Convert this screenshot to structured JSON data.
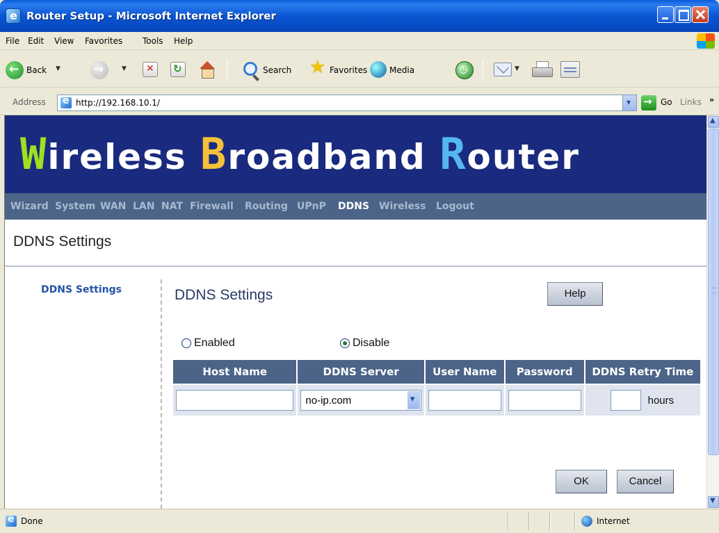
{
  "window": {
    "title": "Router Setup - Microsoft Internet Explorer"
  },
  "menu": [
    "File",
    "Edit",
    "View",
    "Favorites",
    "Tools",
    "Help"
  ],
  "toolbar": {
    "back_label": "Back",
    "search_label": "Search",
    "favorites_label": "Favorites",
    "media_label": "Media"
  },
  "address": {
    "label": "Address",
    "url": "http://192.168.10.1/",
    "go_label": "Go",
    "links_label": "Links"
  },
  "banner": {
    "w": "W",
    "w_rest": "ireless ",
    "b": "B",
    "b_rest": "roadband ",
    "r": "R",
    "r_rest": "outer"
  },
  "nav": {
    "items": [
      "Wizard",
      "System",
      "WAN",
      "LAN",
      "NAT",
      "Firewall",
      "Routing",
      "UPnP",
      "DDNS",
      "Wireless",
      "Logout"
    ],
    "active": "DDNS"
  },
  "page": {
    "heading": "DDNS Settings",
    "sidebar_link": "DDNS Settings",
    "section_title": "DDNS Settings",
    "help_label": "Help",
    "ok_label": "OK",
    "cancel_label": "Cancel"
  },
  "ddns": {
    "enabled_label": "Enabled",
    "disable_label": "Disable",
    "selected": "Disable",
    "columns": [
      "Host Name",
      "DDNS Server",
      "User Name",
      "Password",
      "DDNS Retry Time"
    ],
    "host_name": "",
    "server": "no-ip.com",
    "user_name": "",
    "password": "",
    "retry_time": "",
    "retry_unit": "hours"
  },
  "status": {
    "text": "Done",
    "zone": "Internet"
  },
  "colors": {
    "banner_bg": "#1a2a7e",
    "nav_bg": "#4b6488",
    "cap_w": "#9fe020",
    "cap_b": "#f4c23a",
    "cap_r": "#55b8ec"
  }
}
